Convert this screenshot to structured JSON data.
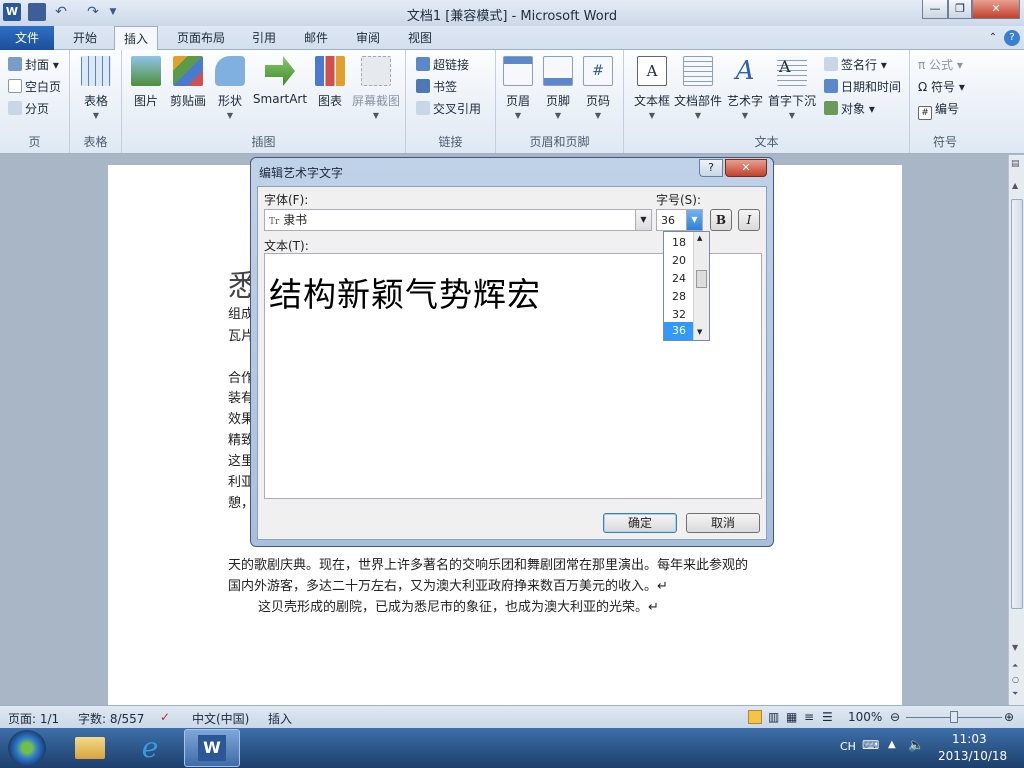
{
  "window": {
    "title": "文档1 [兼容模式] - Microsoft Word"
  },
  "tabs": [
    {
      "label": "文件"
    },
    {
      "label": "开始"
    },
    {
      "label": "插入"
    },
    {
      "label": "页面布局"
    },
    {
      "label": "引用"
    },
    {
      "label": "邮件"
    },
    {
      "label": "审阅"
    },
    {
      "label": "视图"
    }
  ],
  "ribbon": {
    "page": {
      "group": "页",
      "cover": "封面",
      "blank": "空白页",
      "break": "分页"
    },
    "table": {
      "group": "表格",
      "btn": "表格"
    },
    "illus": {
      "group": "插图",
      "picture": "图片",
      "clipart": "剪贴画",
      "shapes": "形状",
      "smartart": "SmartArt",
      "chart": "图表",
      "screenshot": "屏幕截图"
    },
    "links": {
      "group": "链接",
      "hyperlink": "超链接",
      "bookmark": "书签",
      "crossref": "交叉引用"
    },
    "hf": {
      "group": "页眉和页脚",
      "header": "页眉",
      "footer": "页脚",
      "pagenum": "页码"
    },
    "text": {
      "group": "文本",
      "textbox": "文本框",
      "parts": "文档部件",
      "wordart": "艺术字",
      "dropcap": "首字下沉",
      "sigline": "签名行",
      "datetime": "日期和时间",
      "object": "对象"
    },
    "symbols": {
      "group": "符号",
      "equation": "公式",
      "symbol": "符号",
      "number": "编号"
    }
  },
  "document": {
    "lines": [
      "天的歌剧庆典。现在，世界上许多著名的交响乐团和舞剧团常在那里演出。每年来此参观的",
      "国内外游客，多达二十万左右，又为澳大利亚政府挣来数百万美元的收入。↵",
      "这贝壳形成的剧院，已成为悉尼市的象征，也成为澳大利亚的光荣。↵"
    ],
    "left_fragments": [
      "悉",
      "组成",
      "瓦片",
      "合作",
      "装有",
      "效果",
      "精致",
      "这里",
      "利亚",
      "憩，"
    ]
  },
  "dialog": {
    "title": "编辑艺术字文字",
    "help": "?",
    "close": "✕",
    "font_label": "字体(F):",
    "font_value": "隶书",
    "font_icon": "Tr",
    "size_label": "字号(S):",
    "size_value": "36",
    "bold": "B",
    "italic": "I",
    "size_options": [
      "18",
      "20",
      "24",
      "28",
      "32",
      "36"
    ],
    "text_label": "文本(T):",
    "text_value": "结构新颖气势辉宏",
    "ok": "确定",
    "cancel": "取消"
  },
  "status": {
    "page": "页面: 1/1",
    "words": "字数: 8/557",
    "lang": "中文(中国)",
    "mode": "插入",
    "zoom": "100%"
  },
  "taskbar": {
    "ime": "CH",
    "time": "11:03",
    "date": "2013/10/18"
  }
}
